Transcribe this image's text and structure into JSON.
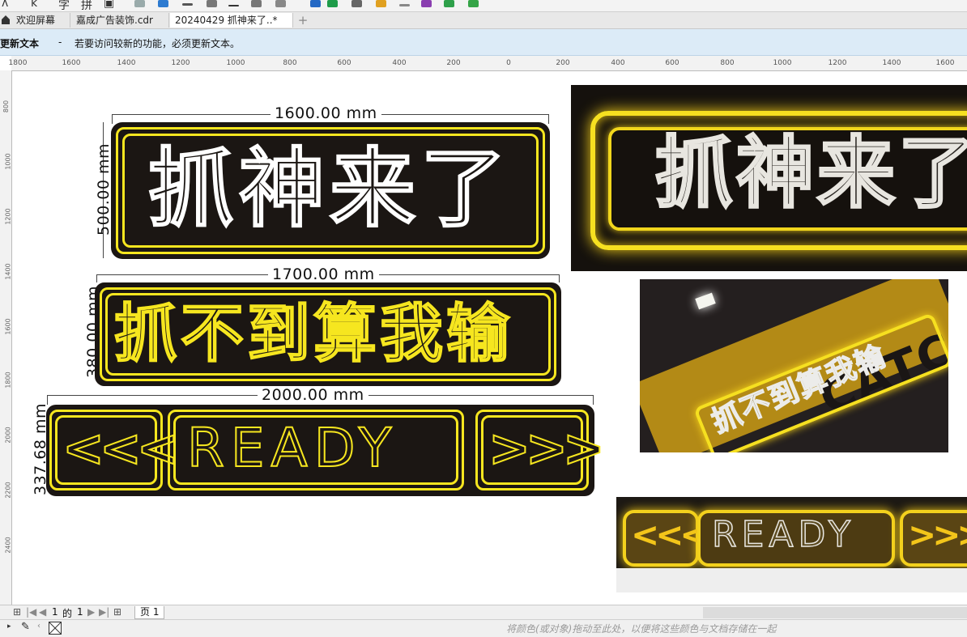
{
  "tabs": {
    "items": [
      {
        "label": "欢迎屏幕"
      },
      {
        "label": "嘉成广告装饰.cdr"
      },
      {
        "label": "20240429 抓神来了..*"
      }
    ],
    "add_label": "+"
  },
  "notice": {
    "title": "更新文本",
    "separator": "-",
    "message": "若要访问较新的功能，必须更新文本。"
  },
  "ruler": {
    "h_ticks": [
      "1800",
      "1600",
      "1400",
      "1200",
      "1000",
      "800",
      "600",
      "400",
      "200",
      "0",
      "200",
      "400",
      "600",
      "800",
      "1000",
      "1200",
      "1400",
      "1600"
    ],
    "v_ticks": [
      "800",
      "1000",
      "1200",
      "1400",
      "1600",
      "1800",
      "2000",
      "2200",
      "2400"
    ]
  },
  "signs": [
    {
      "text": "抓神来了",
      "width_dim": "1600.00 mm",
      "height_dim": "500.00 mm",
      "text_color": "white"
    },
    {
      "text": "抓不到算我输",
      "width_dim": "1700.00 mm",
      "height_dim": "380.00 mm",
      "text_color": "yellow"
    },
    {
      "text": "READY",
      "left_arrows": "<<<",
      "right_arrows": ">>>",
      "width_dim": "2000.00 mm",
      "height_dim": "337.68 mm"
    }
  ],
  "photos": [
    {
      "text": "抓神来了"
    },
    {
      "text": "抓不到算我输",
      "bg_text": "CATCHIN"
    },
    {
      "text": "READY",
      "left_arrows": "<<<",
      "right_arrows": ">>>"
    }
  ],
  "pager": {
    "current": "1",
    "of_label": "的",
    "total": "1",
    "page_tab": "页 1"
  },
  "status": {
    "hint": "将颜色(或对象)拖动至此处，以便将这些颜色与文档存储在一起"
  },
  "colors": {
    "neon_yellow": "#f6e61f",
    "sign_bg": "#1b1613",
    "notice_bg": "#dcebf7"
  }
}
